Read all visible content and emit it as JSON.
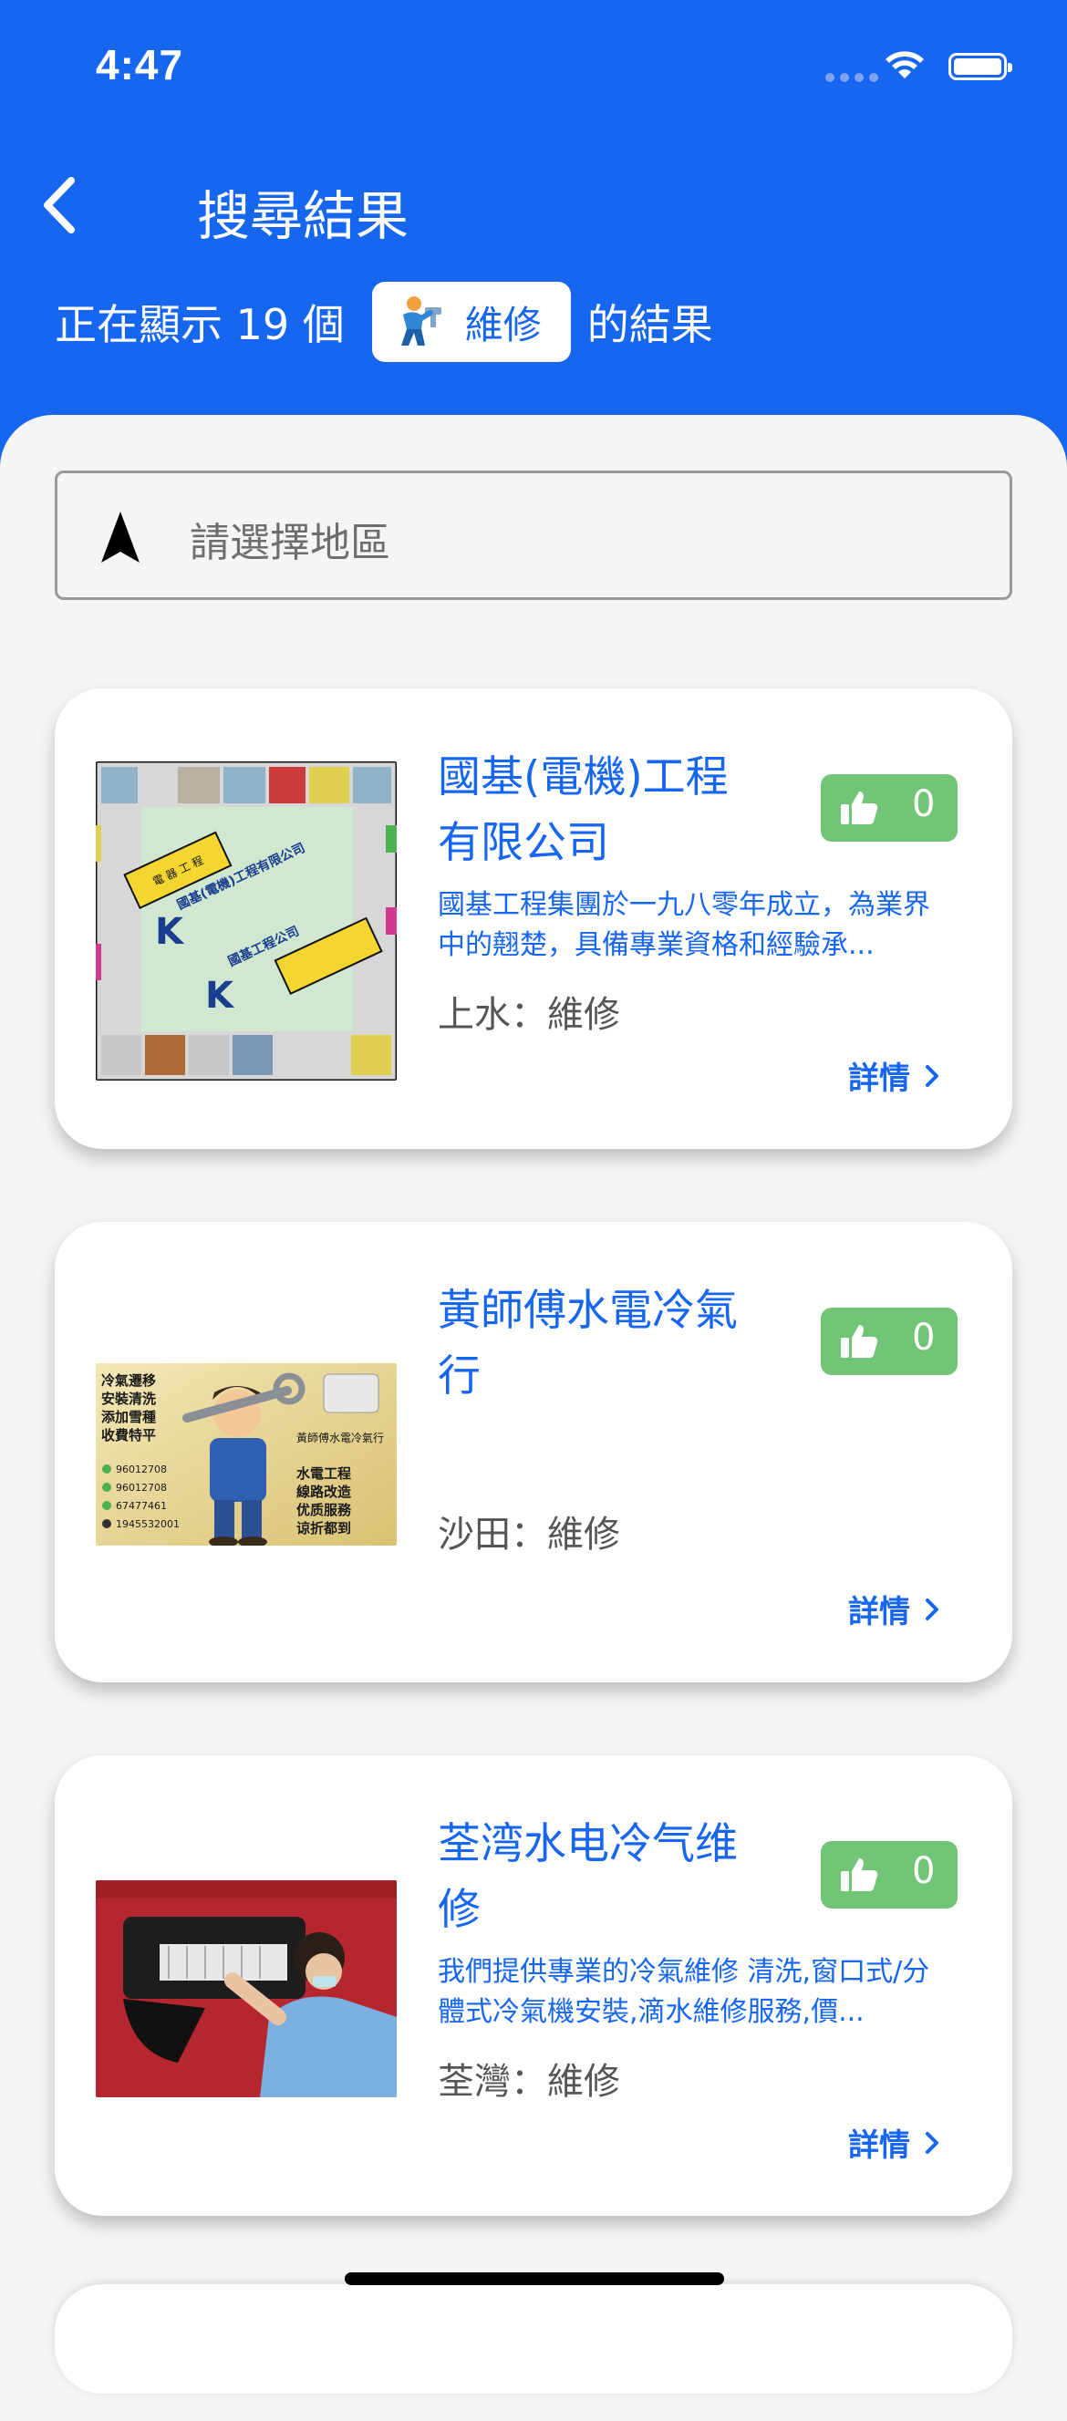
{
  "status_bar": {
    "time": "4:47"
  },
  "header": {
    "title": "搜尋結果"
  },
  "summary": {
    "prefix": "正在顯示 19 個",
    "category": "維修",
    "suffix": "的結果"
  },
  "region": {
    "placeholder": "請選擇地區"
  },
  "cards": [
    {
      "name": "國基(電機)工程有限公司",
      "description": "國基工程集團於一九八零年成立，為業界中的翹楚，具備專業資格和經驗承...",
      "location": "上水：維修",
      "likes": "0",
      "details_label": "詳情"
    },
    {
      "name": "黃師傅水電冷氣行",
      "description": "",
      "location": "沙田：維修",
      "likes": "0",
      "details_label": "詳情"
    },
    {
      "name": "荃湾水电冷气维修",
      "description": "我們提供專業的冷氣維修 清洗,窗口式/分體式冷氣機安裝,滴水維修服務,價...",
      "location": "荃灣：維修",
      "likes": "0",
      "details_label": "詳情"
    }
  ],
  "thumbnail_texts": {
    "card1_company": "國基(電機)工程有限公司",
    "card1_footer": "國基工程公司",
    "card2_services_left": [
      "冷氣遷移",
      "安裝清洗",
      "添加雪種",
      "收費特平"
    ],
    "card2_banner": "黃師傅水電冷氣行",
    "card2_services_right": [
      "水電工程",
      "線路改造",
      "优质服務",
      "谅折都到"
    ],
    "card2_phones": [
      "96012708",
      "96012708",
      "67477461",
      "1945532001"
    ]
  },
  "colors": {
    "primary": "#1766f0",
    "like_bg": "#72c476",
    "sheet_bg": "#f5f5f5"
  }
}
